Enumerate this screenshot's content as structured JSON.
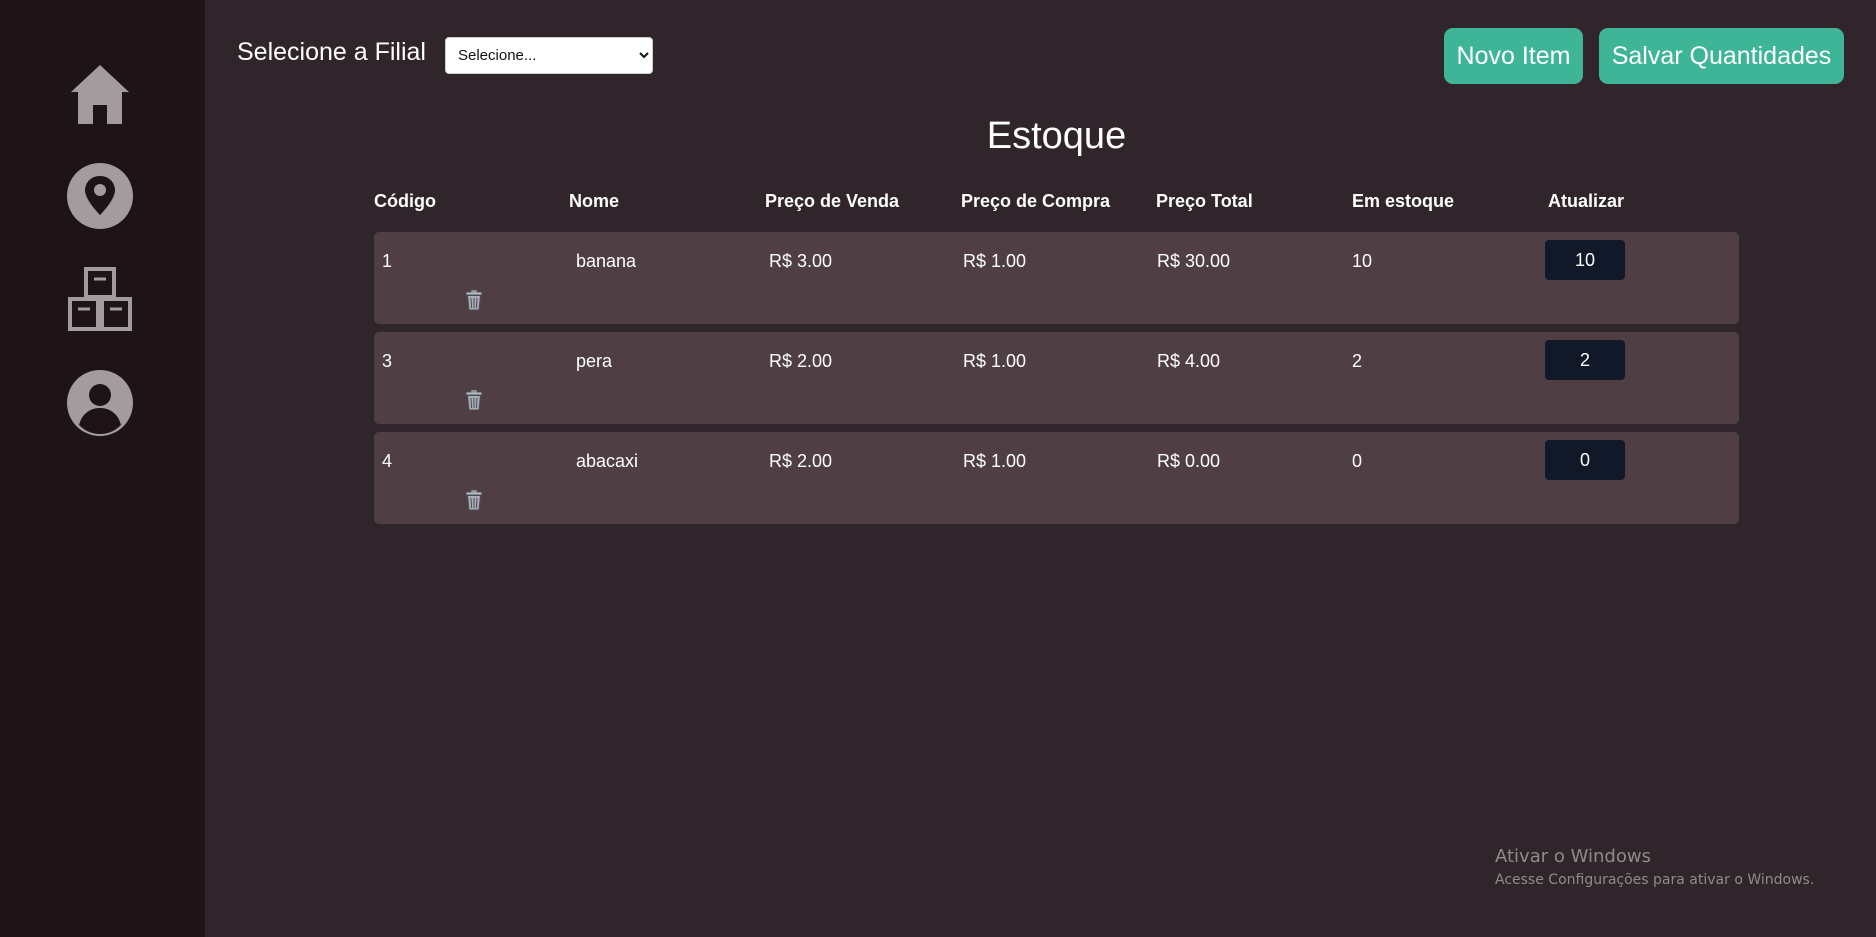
{
  "header": {
    "filial_label": "Selecione a Filial",
    "filial_select_value": "Selecione...",
    "novo_item_label": "Novo Item",
    "salvar_label": "Salvar Quantidades"
  },
  "sidebar": {
    "items": [
      {
        "icon": "home-icon"
      },
      {
        "icon": "location-pin-icon"
      },
      {
        "icon": "boxes-icon"
      },
      {
        "icon": "user-icon"
      }
    ]
  },
  "main": {
    "title": "Estoque",
    "columns": [
      "Código",
      "Nome",
      "Preço de Venda",
      "Preço de Compra",
      "Preço Total",
      "Em estoque",
      "Atualizar"
    ],
    "rows": [
      {
        "codigo": "1",
        "nome": "banana",
        "preco_venda": "R$ 3.00",
        "preco_compra": "R$ 1.00",
        "preco_total": "R$ 30.00",
        "em_estoque": "10",
        "atualizar": "10"
      },
      {
        "codigo": "3",
        "nome": "pera",
        "preco_venda": "R$ 2.00",
        "preco_compra": "R$ 1.00",
        "preco_total": "R$ 4.00",
        "em_estoque": "2",
        "atualizar": "2"
      },
      {
        "codigo": "4",
        "nome": "abacaxi",
        "preco_venda": "R$ 2.00",
        "preco_compra": "R$ 1.00",
        "preco_total": "R$ 0.00",
        "em_estoque": "0",
        "atualizar": "0"
      }
    ]
  },
  "watermark": {
    "title": "Ativar o Windows",
    "subtitle": "Acesse Configurações para ativar o Windows."
  },
  "colors": {
    "background": "#2f252a",
    "sidebar": "#1e1417",
    "row": "#4f3e44",
    "accent": "#3fb597",
    "input_bg": "#111827"
  }
}
